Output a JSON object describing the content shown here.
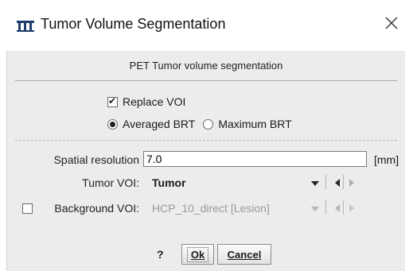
{
  "window": {
    "title": "Tumor Volume Segmentation",
    "app_icon": "pmod-logo-icon",
    "close_icon": "close-icon"
  },
  "section": {
    "title": "PET Tumor volume segmentation"
  },
  "options": {
    "replace_voi": {
      "label": "Replace VOI",
      "checked": true
    },
    "brt_mode": {
      "options": [
        "Averaged BRT",
        "Maximum BRT"
      ],
      "selected": "Averaged BRT"
    }
  },
  "fields": {
    "spatial_resolution": {
      "label": "Spatial resolution",
      "value": "7.0",
      "unit": "[mm]"
    },
    "tumor_voi": {
      "label": "Tumor VOI:",
      "value": "Tumor"
    },
    "background_voi": {
      "label": "Background VOI:",
      "value": "HCP_10_direct [Lesion]",
      "enabled": false
    }
  },
  "buttons": {
    "help": "?",
    "ok": "Ok",
    "cancel": "Cancel"
  },
  "colors": {
    "panel_bg": "#ececec",
    "window_bg": "#ffffff",
    "disabled_text": "#9a9a9a"
  }
}
